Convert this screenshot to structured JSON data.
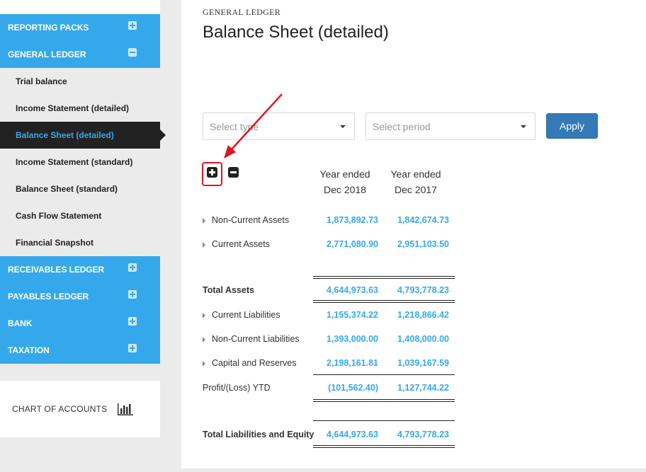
{
  "sidebar": {
    "sections": [
      {
        "label": "REPORTING PACKS",
        "state": "collapsed"
      },
      {
        "label": "GENERAL LEDGER",
        "state": "expanded"
      }
    ],
    "general_ledger_items": [
      {
        "label": "Trial balance"
      },
      {
        "label": "Income Statement (detailed)"
      },
      {
        "label": "Balance Sheet (detailed)",
        "active": true
      },
      {
        "label": "Income Statement (standard)"
      },
      {
        "label": "Balance Sheet (standard)"
      },
      {
        "label": "Cash Flow Statement"
      },
      {
        "label": "Financial Snapshot"
      }
    ],
    "other_sections": [
      {
        "label": "RECEIVABLES LEDGER"
      },
      {
        "label": "PAYABLES LEDGER"
      },
      {
        "label": "BANK"
      },
      {
        "label": "TAXATION"
      }
    ],
    "chart_of_accounts": "CHART OF ACCOUNTS"
  },
  "main": {
    "breadcrumb": "GENERAL LEDGER",
    "title": "Balance Sheet (detailed)",
    "filters": {
      "type_placeholder": "Select type",
      "period_placeholder": "Select period",
      "apply_label": "Apply"
    },
    "columns": [
      {
        "line1": "Year ended",
        "line2": "Dec 2018"
      },
      {
        "line1": "Year ended",
        "line2": "Dec 2017"
      }
    ],
    "rows": [
      {
        "label": "Non-Current Assets",
        "v1": "1,873,892.73",
        "v2": "1,842,674.73"
      },
      {
        "label": "Current Assets",
        "v1": "2,771,080.90",
        "v2": "2,951,103.50"
      },
      {
        "label": "Total Assets",
        "v1": "4,644,973.63",
        "v2": "4,793,778.23"
      },
      {
        "label": "Current Liabilities",
        "v1": "1,155,374.22",
        "v2": "1,218,866.42"
      },
      {
        "label": "Non-Current Liabilities",
        "v1": "1,393,000.00",
        "v2": "1,408,000.00"
      },
      {
        "label": "Capital and Reserves",
        "v1": "2,198,161.81",
        "v2": "1,039,167.59"
      },
      {
        "label": "Profit/(Loss) YTD",
        "v1": "(101,562.40)",
        "v2": "1,127,744.22"
      },
      {
        "label": "Total Liabilities and Equity",
        "v1": "4,644,973.63",
        "v2": "4,793,778.23"
      }
    ]
  },
  "colors": {
    "accent": "#35a8ec",
    "active_bg": "#222222",
    "button": "#337ab7",
    "annotation": "#e0141f"
  },
  "icons": [
    "plus-square-icon",
    "minus-square-icon",
    "bar-chart-icon",
    "caret-down-icon",
    "caret-right-icon",
    "arrow-annotation-icon"
  ]
}
